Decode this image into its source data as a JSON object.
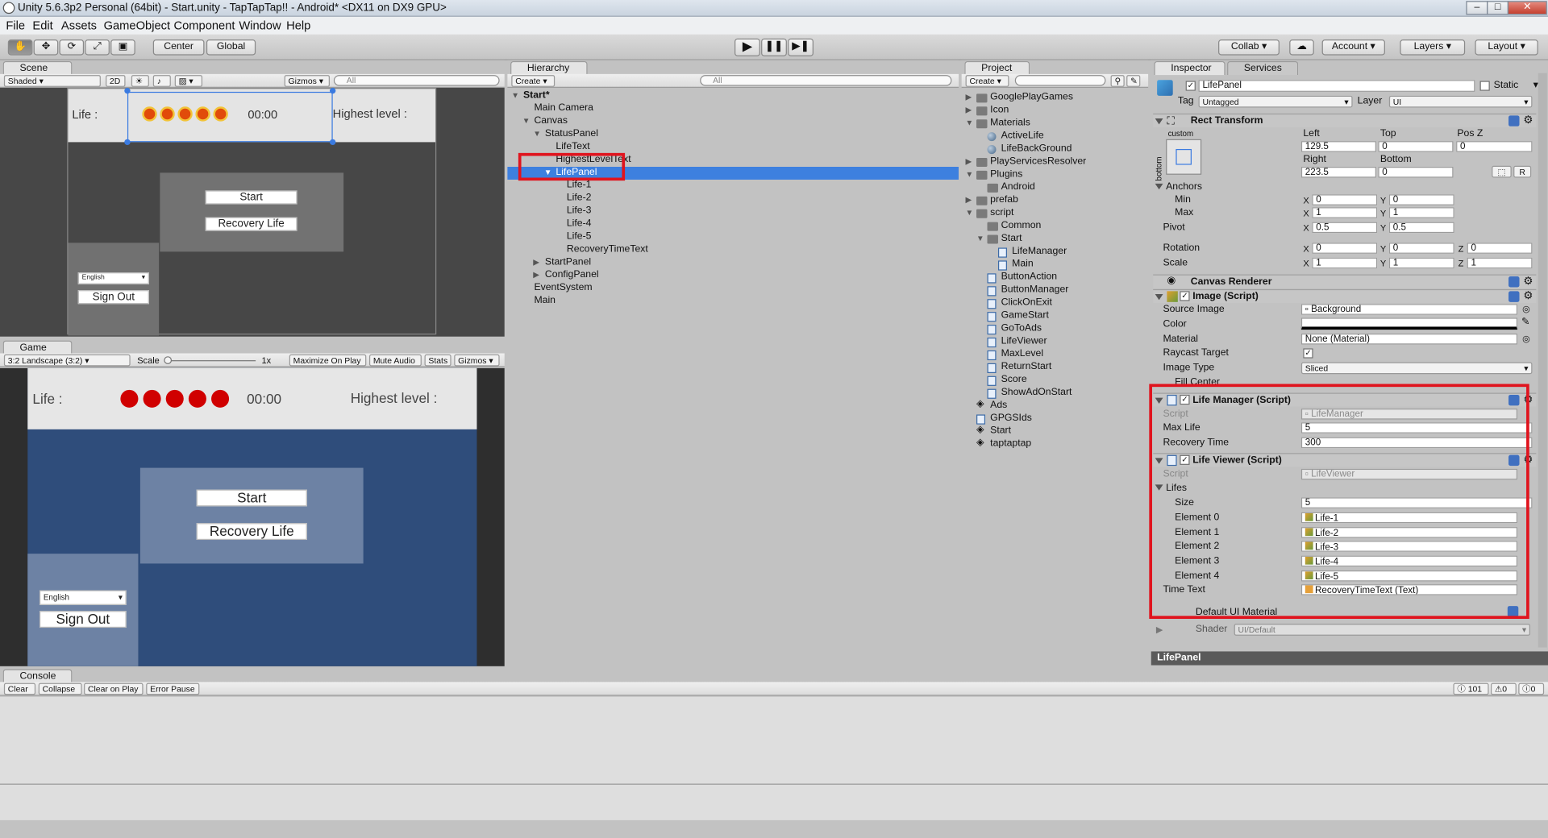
{
  "window": {
    "title": "Unity 5.6.3p2 Personal (64bit) - Start.unity - TapTapTap!! - Android* <DX11 on DX9 GPU>"
  },
  "menu": [
    "File",
    "Edit",
    "Assets",
    "GameObject",
    "Component",
    "Window",
    "Help"
  ],
  "toolbar": {
    "center": "Center",
    "global": "Global",
    "collab": "Collab ▾",
    "account": "Account",
    "layers": "Layers",
    "layout": "Layout"
  },
  "scene": {
    "tab": "Scene",
    "shaded": "Shaded",
    "mode2d": "2D",
    "gizmos": "Gizmos",
    "search": "All",
    "life_label": "Life :",
    "timer": "00:00",
    "highest": "Highest level :",
    "start": "Start",
    "recovery": "Recovery Life",
    "lang": "English",
    "signout": "Sign Out"
  },
  "game": {
    "tab": "Game",
    "aspect": "3:2 Landscape (3:2)",
    "scale": "Scale",
    "scale_value": "1x",
    "maximize": "Maximize On Play",
    "mute": "Mute Audio",
    "stats": "Stats",
    "gizmos": "Gizmos",
    "life_label": "Life :",
    "timer": "00:00",
    "highest": "Highest level :",
    "start": "Start",
    "recovery": "Recovery Life",
    "lang": "English",
    "signout": "Sign Out"
  },
  "hierarchy": {
    "tab": "Hierarchy",
    "create": "Create",
    "search": "All",
    "items": [
      {
        "label": "Start*",
        "indent": 0,
        "arrow": "down",
        "bold": true
      },
      {
        "label": "Main Camera",
        "indent": 1
      },
      {
        "label": "Canvas",
        "indent": 1,
        "arrow": "down"
      },
      {
        "label": "StatusPanel",
        "indent": 2,
        "arrow": "down"
      },
      {
        "label": "LifeText",
        "indent": 3
      },
      {
        "label": "HighestLevelText",
        "indent": 3
      },
      {
        "label": "LifePanel",
        "indent": 3,
        "arrow": "down",
        "selected": true
      },
      {
        "label": "Life-1",
        "indent": 4
      },
      {
        "label": "Life-2",
        "indent": 4
      },
      {
        "label": "Life-3",
        "indent": 4
      },
      {
        "label": "Life-4",
        "indent": 4
      },
      {
        "label": "Life-5",
        "indent": 4
      },
      {
        "label": "RecoveryTimeText",
        "indent": 4
      },
      {
        "label": "StartPanel",
        "indent": 2,
        "arrow": "right"
      },
      {
        "label": "ConfigPanel",
        "indent": 2,
        "arrow": "right"
      },
      {
        "label": "EventSystem",
        "indent": 1
      },
      {
        "label": "Main",
        "indent": 1
      }
    ]
  },
  "project": {
    "tab": "Project",
    "create": "Create",
    "items": [
      {
        "label": "GooglePlayGames",
        "indent": 0,
        "type": "folder",
        "arrow": "right"
      },
      {
        "label": "Icon",
        "indent": 0,
        "type": "folder",
        "arrow": "right"
      },
      {
        "label": "Materials",
        "indent": 0,
        "type": "folder",
        "arrow": "down"
      },
      {
        "label": "ActiveLife",
        "indent": 1,
        "type": "material"
      },
      {
        "label": "LifeBackGround",
        "indent": 1,
        "type": "material"
      },
      {
        "label": "PlayServicesResolver",
        "indent": 0,
        "type": "folder",
        "arrow": "right"
      },
      {
        "label": "Plugins",
        "indent": 0,
        "type": "folder",
        "arrow": "down"
      },
      {
        "label": "Android",
        "indent": 1,
        "type": "folder"
      },
      {
        "label": "prefab",
        "indent": 0,
        "type": "folder",
        "arrow": "right"
      },
      {
        "label": "script",
        "indent": 0,
        "type": "folder",
        "arrow": "down"
      },
      {
        "label": "Common",
        "indent": 1,
        "type": "folder"
      },
      {
        "label": "Start",
        "indent": 1,
        "type": "folder",
        "arrow": "down"
      },
      {
        "label": "LifeManager",
        "indent": 2,
        "type": "script"
      },
      {
        "label": "Main",
        "indent": 2,
        "type": "script"
      },
      {
        "label": "ButtonAction",
        "indent": 1,
        "type": "script"
      },
      {
        "label": "ButtonManager",
        "indent": 1,
        "type": "script"
      },
      {
        "label": "ClickOnExit",
        "indent": 1,
        "type": "script"
      },
      {
        "label": "GameStart",
        "indent": 1,
        "type": "script"
      },
      {
        "label": "GoToAds",
        "indent": 1,
        "type": "script"
      },
      {
        "label": "LifeViewer",
        "indent": 1,
        "type": "script"
      },
      {
        "label": "MaxLevel",
        "indent": 1,
        "type": "script"
      },
      {
        "label": "ReturnStart",
        "indent": 1,
        "type": "script"
      },
      {
        "label": "Score",
        "indent": 1,
        "type": "script"
      },
      {
        "label": "ShowAdOnStart",
        "indent": 1,
        "type": "script"
      },
      {
        "label": "Ads",
        "indent": 0,
        "type": "unity"
      },
      {
        "label": "GPGSIds",
        "indent": 0,
        "type": "script"
      },
      {
        "label": "Start",
        "indent": 0,
        "type": "unity"
      },
      {
        "label": "taptaptap",
        "indent": 0,
        "type": "unity"
      }
    ]
  },
  "inspector": {
    "tab": "Inspector",
    "services_tab": "Services",
    "name": "LifePanel",
    "static": "Static",
    "tag_label": "Tag",
    "tag": "Untagged",
    "layer_label": "Layer",
    "layer": "UI",
    "rect": {
      "title": "Rect Transform",
      "custom": "custom",
      "bottom": "bottom",
      "left_label": "Left",
      "top_label": "Top",
      "posz_label": "Pos Z",
      "left": "129.5",
      "top": "0",
      "posz": "0",
      "right_label": "Right",
      "bottom_label": "Bottom",
      "right": "223.5",
      "bottom_val": "0",
      "r_btn": "R",
      "anchors": "Anchors",
      "min": "Min",
      "max": "Max",
      "pivot": "Pivot",
      "rotation": "Rotation",
      "scale": "Scale",
      "min_x": "0",
      "min_y": "0",
      "max_x": "1",
      "max_y": "1",
      "pivot_x": "0.5",
      "pivot_y": "0.5",
      "rot_x": "0",
      "rot_y": "0",
      "rot_z": "0",
      "scale_x": "1",
      "scale_y": "1",
      "scale_z": "1",
      "x": "X",
      "y": "Y",
      "z": "Z"
    },
    "canvas_renderer": "Canvas Renderer",
    "image": {
      "title": "Image (Script)",
      "source_label": "Source Image",
      "source": "Background",
      "color_label": "Color",
      "material_label": "Material",
      "material": "None (Material)",
      "raycast_label": "Raycast Target",
      "imgtype_label": "Image Type",
      "imgtype": "Sliced",
      "fill_label": "Fill Center"
    },
    "life_manager": {
      "title": "Life Manager (Script)",
      "script_label": "Script",
      "script": "LifeManager",
      "maxlife_label": "Max Life",
      "maxlife": "5",
      "recovery_label": "Recovery Time",
      "recovery": "300"
    },
    "life_viewer": {
      "title": "Life Viewer (Script)",
      "script_label": "Script",
      "script": "LifeViewer",
      "lifes_label": "Lifes",
      "size_label": "Size",
      "size": "5",
      "elements": [
        {
          "label": "Element 0",
          "value": "Life-1"
        },
        {
          "label": "Element 1",
          "value": "Life-2"
        },
        {
          "label": "Element 2",
          "value": "Life-3"
        },
        {
          "label": "Element 3",
          "value": "Life-4"
        },
        {
          "label": "Element 4",
          "value": "Life-5"
        }
      ],
      "timetext_label": "Time Text",
      "timetext": "RecoveryTimeText (Text)"
    },
    "default_material": "Default UI Material",
    "shader_label": "Shader",
    "shader": "UI/Default",
    "footer": "LifePanel"
  },
  "console": {
    "tab": "Console",
    "clear": "Clear",
    "collapse": "Collapse",
    "clear_on_play": "Clear on Play",
    "error_pause": "Error Pause",
    "info_count": "101",
    "warn_count": "0",
    "err_count": "0"
  }
}
